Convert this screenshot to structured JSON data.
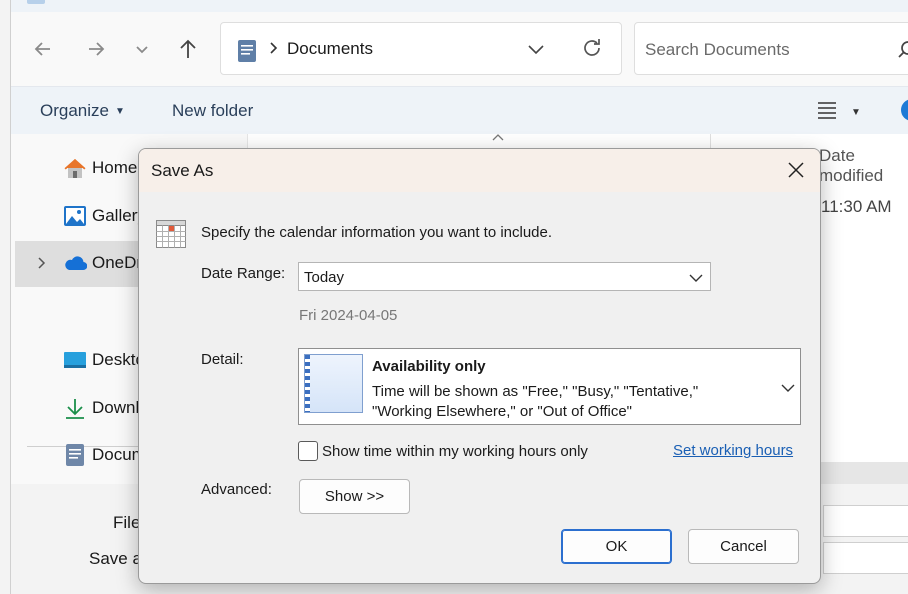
{
  "explorer": {
    "address": {
      "crumb": "Documents"
    },
    "search": {
      "placeholder": "Search Documents"
    },
    "command_bar": {
      "organize": "Organize",
      "new_folder": "New folder"
    },
    "sidebar": {
      "items": [
        {
          "label": "Home",
          "icon": "home-icon"
        },
        {
          "label": "Gallery",
          "icon": "gallery-icon"
        },
        {
          "label": "OneDrive",
          "icon": "onedrive-icon"
        },
        {
          "label": "Desktop",
          "icon": "desktop-icon"
        },
        {
          "label": "Downloads",
          "icon": "downloads-icon"
        },
        {
          "label": "Documents",
          "icon": "documents-icon"
        }
      ]
    },
    "file_list": {
      "column_header": "Date modified",
      "row_time": "11:30 AM"
    },
    "bottom": {
      "file_name_label": "File name:",
      "save_as_type_label": "Save as type:"
    }
  },
  "dialog": {
    "title": "Save As",
    "intro": "Specify the calendar information you want to include.",
    "date_range": {
      "label": "Date Range:",
      "value": "Today",
      "hint": "Fri 2024-04-05"
    },
    "detail": {
      "label": "Detail:",
      "title": "Availability only",
      "description": "Time will be shown as \"Free,\" \"Busy,\" \"Tentative,\" \"Working Elsewhere,\" or \"Out of Office\""
    },
    "working_hours_checkbox": {
      "label": "Show time within my working hours only",
      "checked": false
    },
    "set_working_hours_link": "Set working hours",
    "advanced": {
      "label": "Advanced:",
      "button": "Show >>"
    },
    "ok": "OK",
    "cancel": "Cancel"
  },
  "colors": {
    "accent": "#1e7ad6",
    "link": "#1a5fb4",
    "ok_border": "#2b6fcf"
  }
}
